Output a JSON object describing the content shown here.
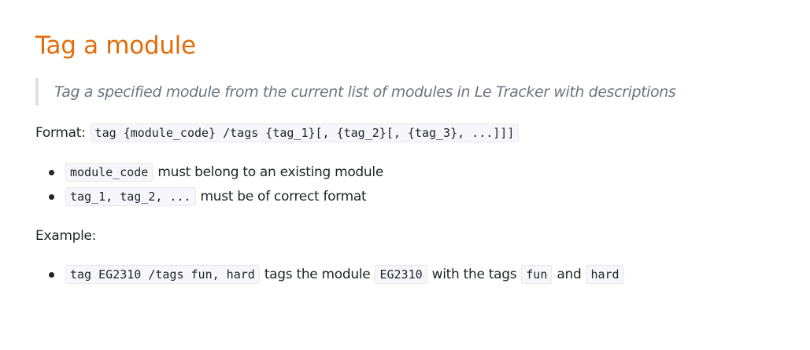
{
  "section": {
    "title": "Tag a module",
    "description": "Tag a specified module from the current list of modules in Le Tracker with descriptions"
  },
  "format": {
    "label": "Format:",
    "syntax": "tag {module_code} /tags {tag_1}[, {tag_2}[, {tag_3}, ...]]]"
  },
  "rules": [
    {
      "code": "module_code",
      "text": "must belong to an existing module"
    },
    {
      "code": "tag_1, tag_2, ...",
      "text": "must be of correct format"
    }
  ],
  "example": {
    "label": "Example:",
    "command": "tag EG2310 /tags fun, hard",
    "text_1": "tags the module",
    "module": "EG2310",
    "text_2": "with the tags",
    "tag_a": "fun",
    "text_3": "and",
    "tag_b": "hard"
  }
}
